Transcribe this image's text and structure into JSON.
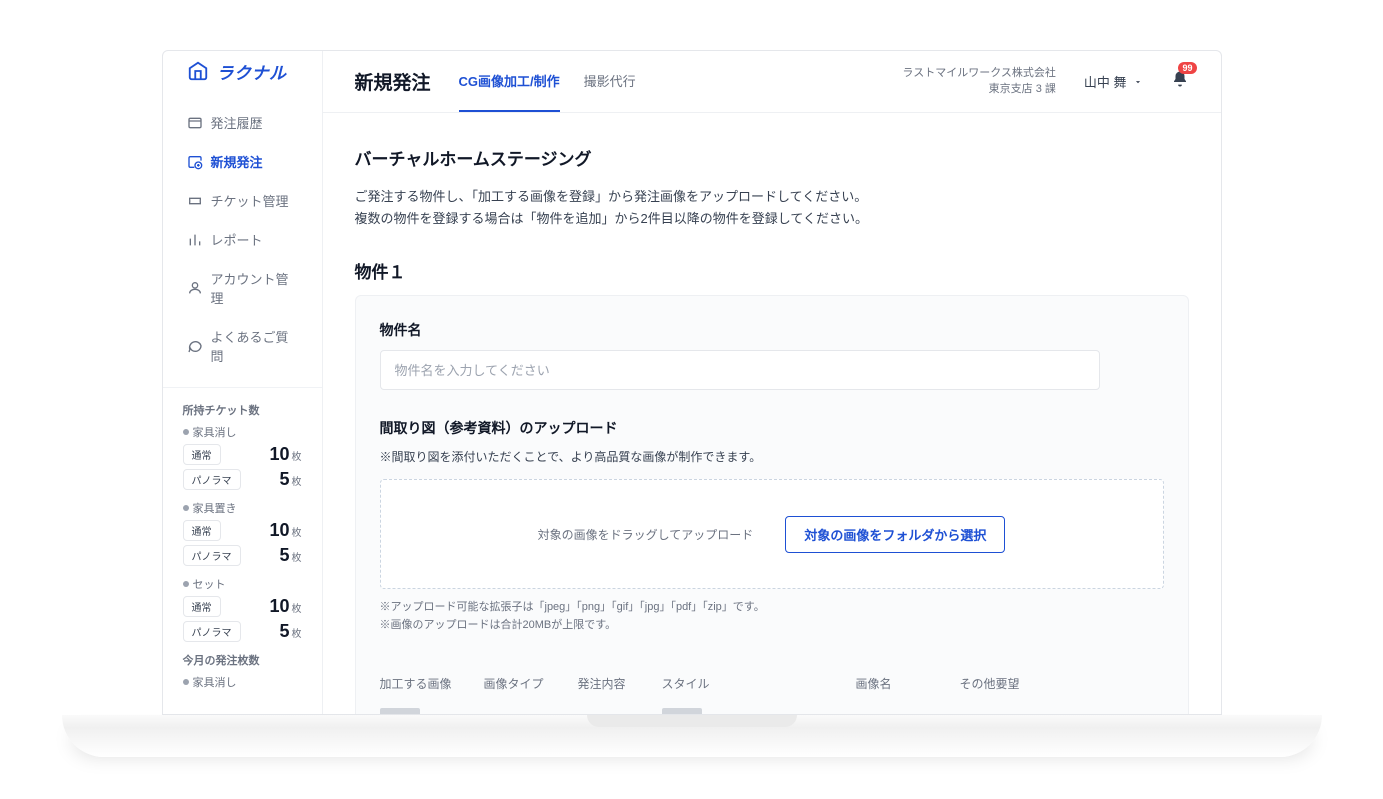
{
  "logo": {
    "text": "ラクナル"
  },
  "sidebar": {
    "items": [
      {
        "label": "発注履歴",
        "icon": "history"
      },
      {
        "label": "新規発注",
        "icon": "new-order",
        "active": true
      },
      {
        "label": "チケット管理",
        "icon": "ticket"
      },
      {
        "label": "レポート",
        "icon": "report"
      },
      {
        "label": "アカウント管理",
        "icon": "account"
      },
      {
        "label": "よくあるご質問",
        "icon": "faq"
      }
    ],
    "ticket_panel": {
      "title": "所持チケット数",
      "groups": [
        {
          "name": "家具消し",
          "rows": [
            {
              "tag": "通常",
              "count": "10",
              "unit": "枚"
            },
            {
              "tag": "パノラマ",
              "count": "5",
              "unit": "枚"
            }
          ]
        },
        {
          "name": "家具置き",
          "rows": [
            {
              "tag": "通常",
              "count": "10",
              "unit": "枚"
            },
            {
              "tag": "パノラマ",
              "count": "5",
              "unit": "枚"
            }
          ]
        },
        {
          "name": "セット",
          "rows": [
            {
              "tag": "通常",
              "count": "10",
              "unit": "枚"
            },
            {
              "tag": "パノラマ",
              "count": "5",
              "unit": "枚"
            }
          ]
        }
      ],
      "month_title": "今月の発注枚数",
      "month_groups": [
        {
          "name": "家具消し"
        }
      ]
    }
  },
  "header": {
    "title": "新規発注",
    "tabs": [
      {
        "label": "CG画像加工/制作",
        "active": true
      },
      {
        "label": "撮影代行"
      }
    ],
    "company_line1": "ラストマイルワークス株式会社",
    "company_line2": "東京支店 3 課",
    "user_name": "山中 舞",
    "notification_count": "99"
  },
  "content": {
    "section_title": "バーチャルホームステージング",
    "desc_line1": "ご発注する物件し、「加工する画像を登録」から発注画像をアップロードしてください。",
    "desc_line2": "複数の物件を登録する場合は「物件を追加」から2件目以降の物件を登録してください。",
    "property_heading": "物件１",
    "property_name_label": "物件名",
    "property_name_placeholder": "物件名を入力してください",
    "floorplan_label": "間取り図（参考資料）のアップロード",
    "floorplan_help": "※間取り図を添付いただくことで、より高品質な画像が制作できます。",
    "dropzone_text": "対象の画像をドラッグしてアップロード",
    "select_button": "対象の画像をフォルダから選択",
    "note_line1": "※アップロード可能な拡張子は「jpeg」「png」「gif」「jpg」「pdf」「zip」です。",
    "note_line2": "※画像のアップロードは合計20MBが上限です。",
    "table_headers": {
      "h1": "加工する画像",
      "h2": "画像タイプ",
      "h3": "発注内容",
      "h4": "スタイル",
      "h5": "画像名",
      "h6": "その他要望"
    }
  }
}
